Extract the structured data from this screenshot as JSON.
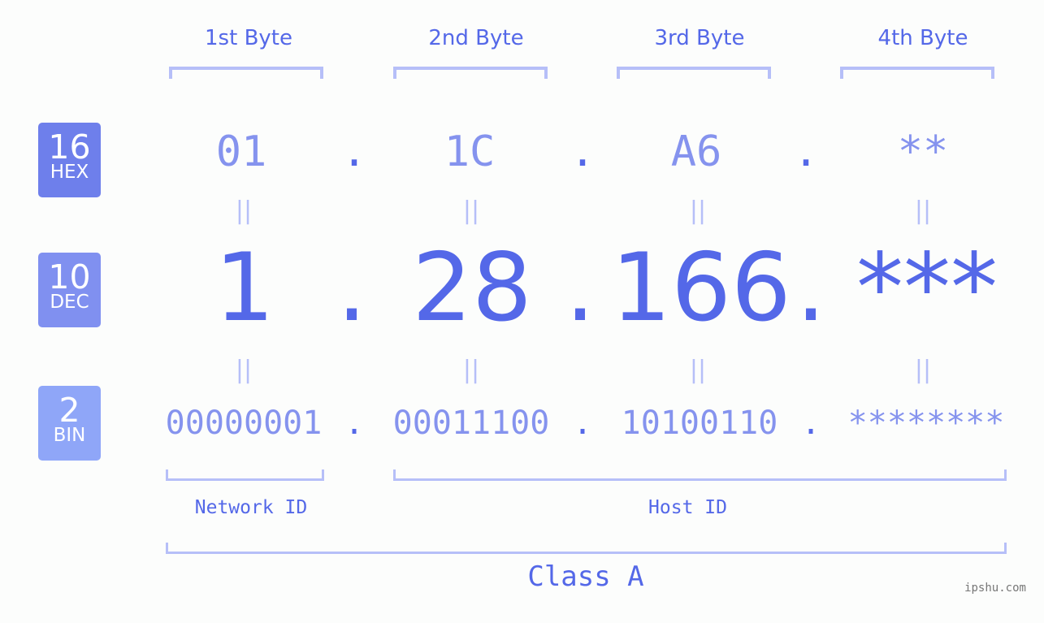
{
  "headers": {
    "bytes": [
      "1st Byte",
      "2nd Byte",
      "3rd Byte",
      "4th Byte"
    ]
  },
  "badges": {
    "hex": {
      "number": "16",
      "unit": "HEX",
      "color": "#6e7feb"
    },
    "dec": {
      "number": "10",
      "unit": "DEC",
      "color": "#8090f0"
    },
    "bin": {
      "number": "2",
      "unit": "BIN",
      "color": "#8fa6f8"
    }
  },
  "rows": {
    "hex": [
      "01",
      "1C",
      "A6",
      "**"
    ],
    "dec": [
      "1",
      "28",
      "166",
      "***"
    ],
    "bin": [
      "00000001",
      "00011100",
      "10100110",
      "********"
    ]
  },
  "separator": ".",
  "equals": "||",
  "segments": {
    "network_id": "Network ID",
    "host_id": "Host ID"
  },
  "class_label": "Class A",
  "watermark": "ipshu.com",
  "colors": {
    "accent": "#5468e8",
    "light_value": "#8593ee",
    "bracket": "#b6bff8",
    "background": "#fcfdfc"
  }
}
